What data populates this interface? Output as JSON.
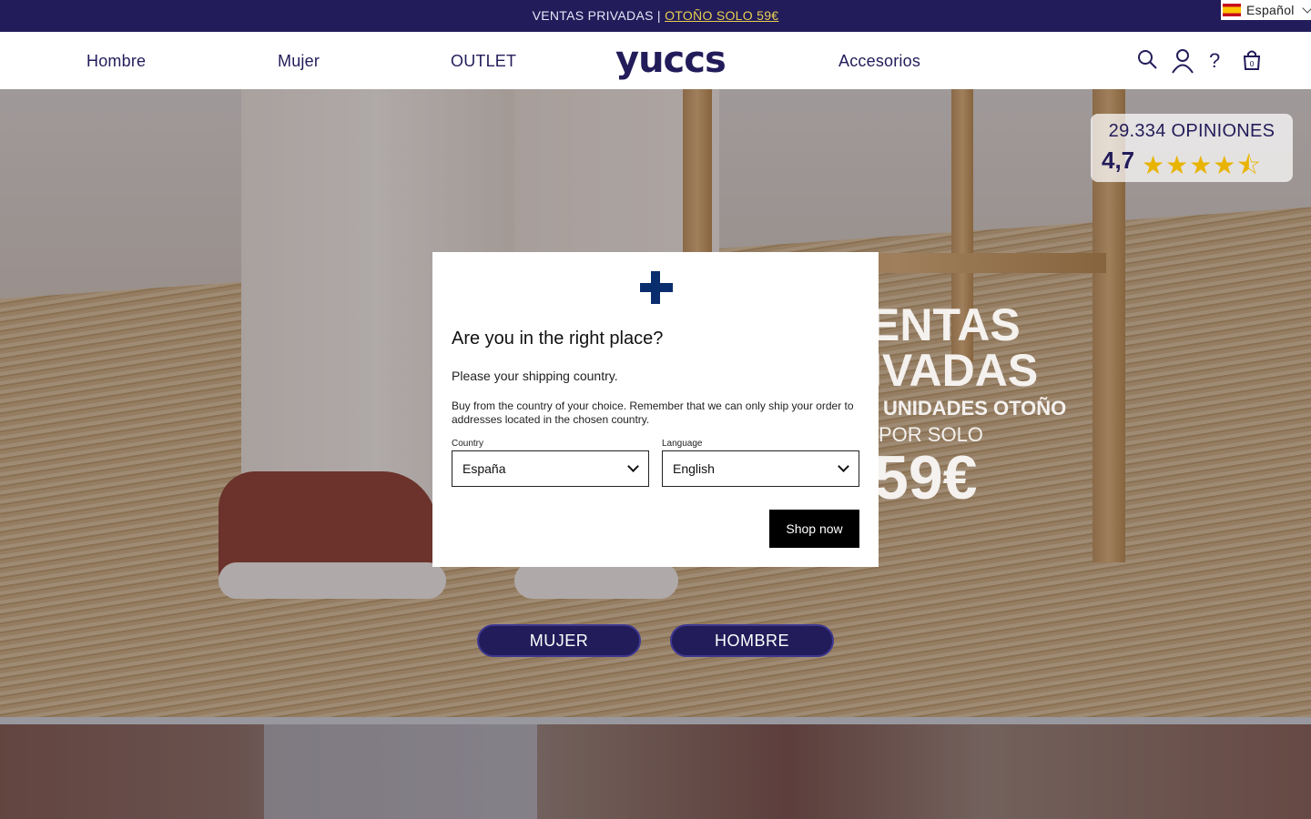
{
  "topbar": {
    "message": "VENTAS PRIVADAS | ",
    "link": "OTOÑO SOLO 59€",
    "language": "Español",
    "language_flag": "spain-flag-icon"
  },
  "header": {
    "logo": "yuccs",
    "nav": {
      "hombre": "Hombre",
      "mujer": "Mujer",
      "outlet": "OUTLET",
      "accesorios": "Accesorios"
    },
    "icons": [
      "search-icon",
      "user-icon",
      "help-icon",
      "bag-icon"
    ],
    "help_glyph": "?"
  },
  "rating": {
    "count": "29.334 OPINIONES",
    "score": "4,7",
    "stars": 4.7,
    "stars_glyphs": "★★★★⯪"
  },
  "promo": {
    "line1": "ENTAS",
    "line2": "IVADAS",
    "line3": "UNIDADES OTOÑO",
    "line4": "POR SOLO",
    "price": "59€"
  },
  "cta": {
    "mujer": "MUJER",
    "hombre": "HOMBRE"
  },
  "modal": {
    "title": "Are you in the right place?",
    "subtitle": "Please your shipping country.",
    "description": "Buy from the country of your choice. Remember that we can only ship your order to addresses located in the chosen country.",
    "country_label": "Country",
    "country_value": "España",
    "language_label": "Language",
    "language_value": "English",
    "shop_button": "Shop now",
    "emblem_icon": "finland-flag-cross-icon"
  },
  "colors": {
    "brand": "#221c5a",
    "accent_link": "#e9cf52",
    "star": "#e8b400",
    "button": "#000000"
  }
}
